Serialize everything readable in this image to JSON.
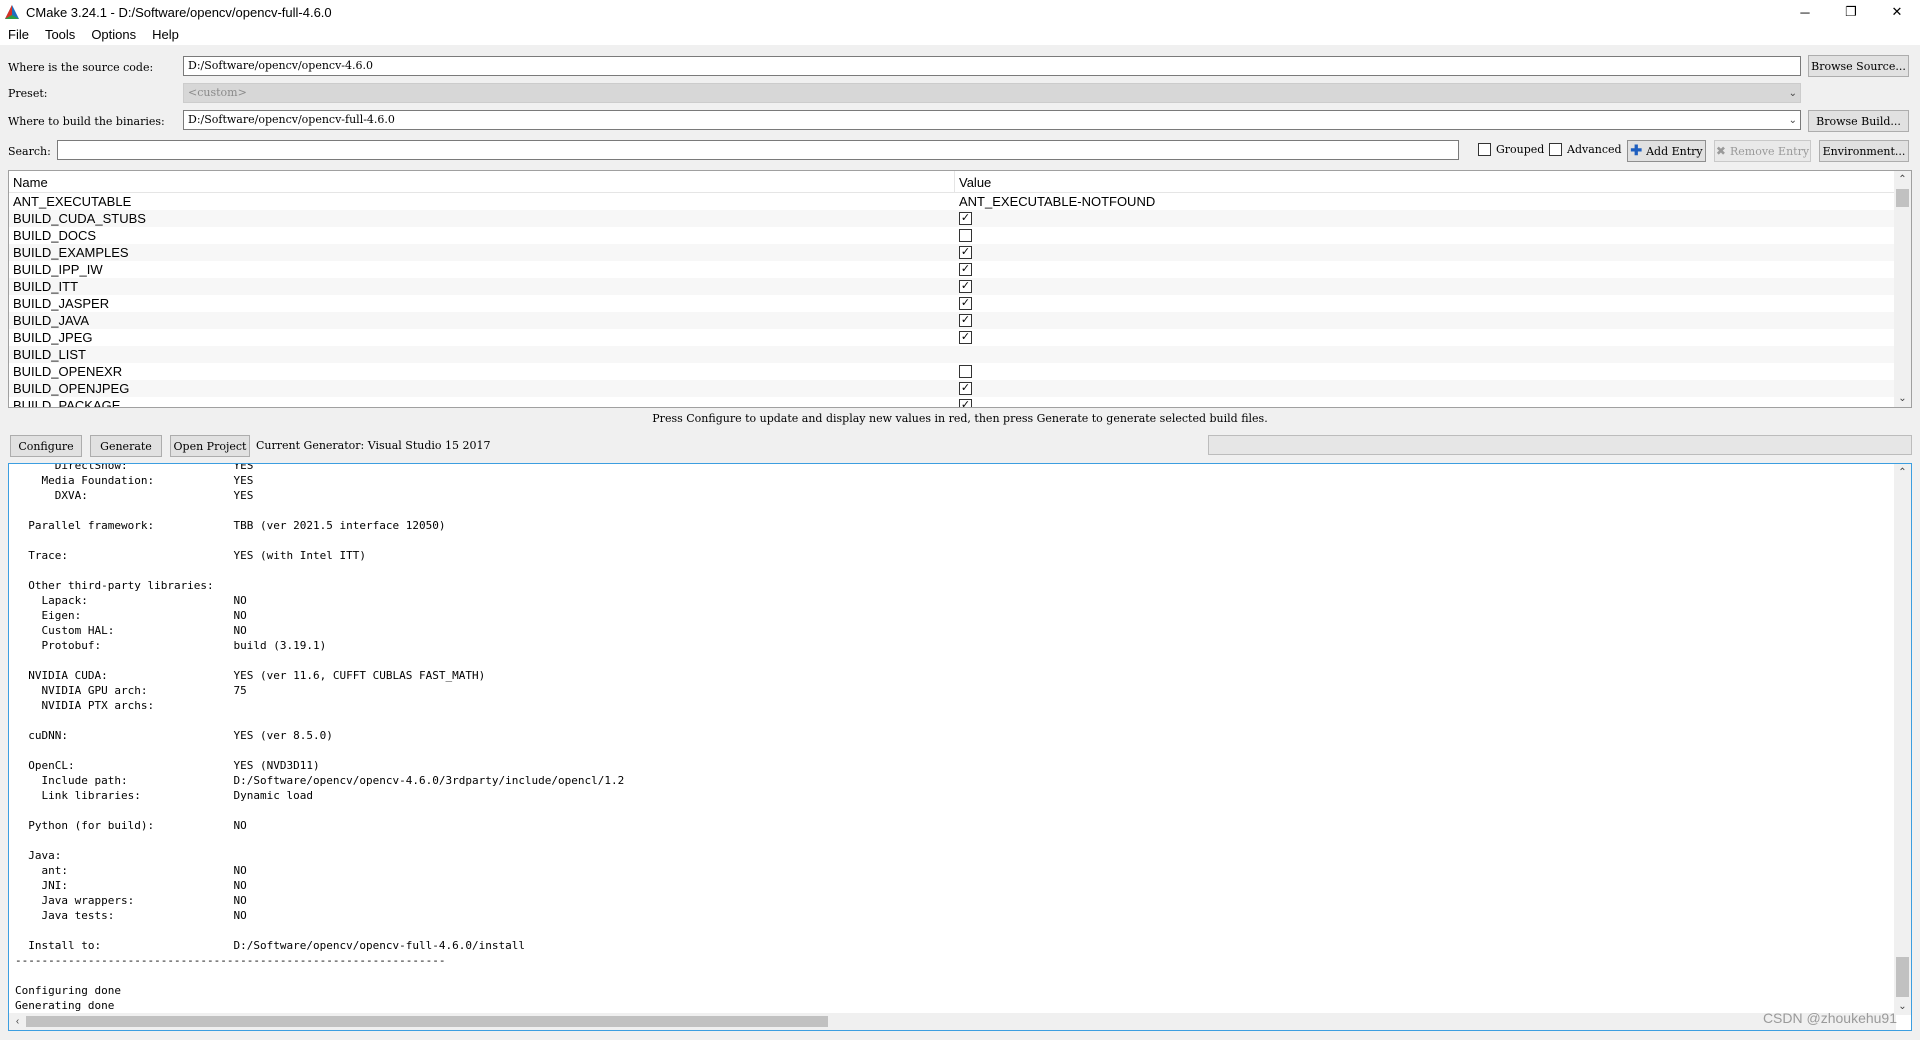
{
  "window": {
    "title": "CMake 3.24.1 - D:/Software/opencv/opencv-full-4.6.0",
    "minimize": "─",
    "restore": "❐",
    "close": "✕"
  },
  "menu": [
    "File",
    "Tools",
    "Options",
    "Help"
  ],
  "source": {
    "label": "Where is the source code:",
    "value": "D:/Software/opencv/opencv-4.6.0",
    "button": "Browse Source..."
  },
  "preset": {
    "label": "Preset:",
    "value": "<custom>"
  },
  "build": {
    "label": "Where to build the binaries:",
    "value": "D:/Software/opencv/opencv-full-4.6.0",
    "button": "Browse Build..."
  },
  "search": {
    "label": "Search:",
    "value": "",
    "grouped": "Grouped",
    "advanced": "Advanced",
    "add_entry": "Add Entry",
    "remove_entry": "Remove Entry",
    "environment": "Environment..."
  },
  "table": {
    "headers": [
      "Name",
      "Value"
    ],
    "rows": [
      {
        "name": "ANT_EXECUTABLE",
        "value": "ANT_EXECUTABLE-NOTFOUND",
        "type": "text"
      },
      {
        "name": "BUILD_CUDA_STUBS",
        "value": "checked",
        "type": "bool"
      },
      {
        "name": "BUILD_DOCS",
        "value": "unchecked",
        "type": "bool"
      },
      {
        "name": "BUILD_EXAMPLES",
        "value": "checked",
        "type": "bool"
      },
      {
        "name": "BUILD_IPP_IW",
        "value": "checked",
        "type": "bool"
      },
      {
        "name": "BUILD_ITT",
        "value": "checked",
        "type": "bool"
      },
      {
        "name": "BUILD_JASPER",
        "value": "checked",
        "type": "bool"
      },
      {
        "name": "BUILD_JAVA",
        "value": "checked",
        "type": "bool"
      },
      {
        "name": "BUILD_JPEG",
        "value": "checked",
        "type": "bool"
      },
      {
        "name": "BUILD_LIST",
        "value": "",
        "type": "text"
      },
      {
        "name": "BUILD_OPENEXR",
        "value": "unchecked",
        "type": "bool"
      },
      {
        "name": "BUILD_OPENJPEG",
        "value": "checked",
        "type": "bool"
      },
      {
        "name": "BUILD_PACKAGE",
        "value": "checked",
        "type": "bool"
      }
    ]
  },
  "hint": "Press Configure to update and display new values in red, then press Generate to generate selected build files.",
  "actions": {
    "configure": "Configure",
    "generate": "Generate",
    "open_project": "Open Project",
    "generator": "Current Generator: Visual Studio 15 2017"
  },
  "output": {
    "lines": [
      "      DirectShow:                YES",
      "    Media Foundation:            YES",
      "      DXVA:                      YES",
      "",
      "  Parallel framework:            TBB (ver 2021.5 interface 12050)",
      "",
      "  Trace:                         YES (with Intel ITT)",
      "",
      "  Other third-party libraries:",
      "    Lapack:                      NO",
      "    Eigen:                       NO",
      "    Custom HAL:                  NO",
      "    Protobuf:                    build (3.19.1)",
      "",
      "  NVIDIA CUDA:                   YES (ver 11.6, CUFFT CUBLAS FAST_MATH)",
      "    NVIDIA GPU arch:             75",
      "    NVIDIA PTX archs:",
      "",
      "  cuDNN:                         YES (ver 8.5.0)",
      "",
      "  OpenCL:                        YES (NVD3D11)",
      "    Include path:                D:/Software/opencv/opencv-4.6.0/3rdparty/include/opencl/1.2",
      "    Link libraries:              Dynamic load",
      "",
      "  Python (for build):            NO",
      "",
      "  Java:",
      "    ant:                         NO",
      "    JNI:                         NO",
      "    Java wrappers:               NO",
      "    Java tests:                  NO",
      "",
      "  Install to:                    D:/Software/opencv/opencv-full-4.6.0/install",
      "-----------------------------------------------------------------",
      "",
      "Configuring done",
      "Generating done"
    ]
  },
  "watermark": "CSDN @zhoukehu91",
  "colors": {
    "accent": "#3c9ee0",
    "add_icon": "#1f5fbf",
    "window_bg": "#f0f0f0"
  }
}
